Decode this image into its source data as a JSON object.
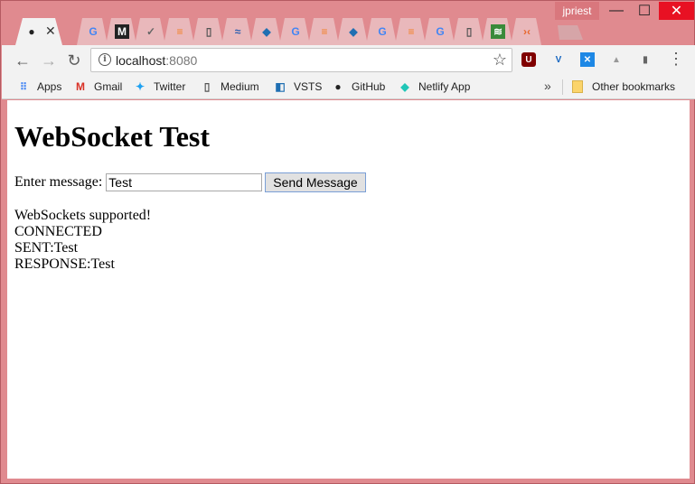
{
  "window": {
    "user": "jpriest",
    "minimize_glyph": "—",
    "maximize_glyph": "☐",
    "close_glyph": "✕"
  },
  "tabs": [
    {
      "icon": "github-icon",
      "glyph": "●",
      "active": true,
      "close": "✕"
    },
    {
      "icon": "google-icon",
      "glyph": "G"
    },
    {
      "icon": "medium-icon",
      "glyph": "M"
    },
    {
      "icon": "bird-icon",
      "glyph": "✓"
    },
    {
      "icon": "stackoverflow-icon",
      "glyph": "≡"
    },
    {
      "icon": "page-icon",
      "glyph": "▯"
    },
    {
      "icon": "wave-icon",
      "glyph": "≈"
    },
    {
      "icon": "app-icon",
      "glyph": "◆"
    },
    {
      "icon": "google-icon",
      "glyph": "G"
    },
    {
      "icon": "stackoverflow-icon",
      "glyph": "≡"
    },
    {
      "icon": "app-icon",
      "glyph": "◆"
    },
    {
      "icon": "google-icon",
      "glyph": "G"
    },
    {
      "icon": "stackoverflow-icon",
      "glyph": "≡"
    },
    {
      "icon": "google-icon",
      "glyph": "G"
    },
    {
      "icon": "page-icon",
      "glyph": "▯"
    },
    {
      "icon": "code-icon",
      "glyph": "≋"
    },
    {
      "icon": "chevrons-icon",
      "glyph": "›‹"
    }
  ],
  "toolbar": {
    "back": "←",
    "forward": "→",
    "reload": "↻",
    "url_host": "localhost",
    "url_port": ":8080",
    "star": "☆"
  },
  "extensions": [
    "U",
    "V",
    "✕",
    "▲",
    "▮"
  ],
  "bookmarks": {
    "items": [
      {
        "label": "Apps"
      },
      {
        "label": "Gmail"
      },
      {
        "label": "Twitter"
      },
      {
        "label": "Medium"
      },
      {
        "label": "VSTS"
      },
      {
        "label": "GitHub"
      },
      {
        "label": "Netlify App"
      }
    ],
    "more": "»",
    "other": "Other bookmarks"
  },
  "page": {
    "heading": "WebSocket Test",
    "message_label": "Enter message:",
    "message_value": "Test",
    "send_label": "Send Message",
    "log": [
      "WebSockets supported!",
      "CONNECTED",
      "SENT:Test",
      "RESPONSE:Test"
    ]
  },
  "colors": {
    "frame": "#e08a8f",
    "close_button": "#e81123",
    "toolbar": "#f2f2f2"
  }
}
